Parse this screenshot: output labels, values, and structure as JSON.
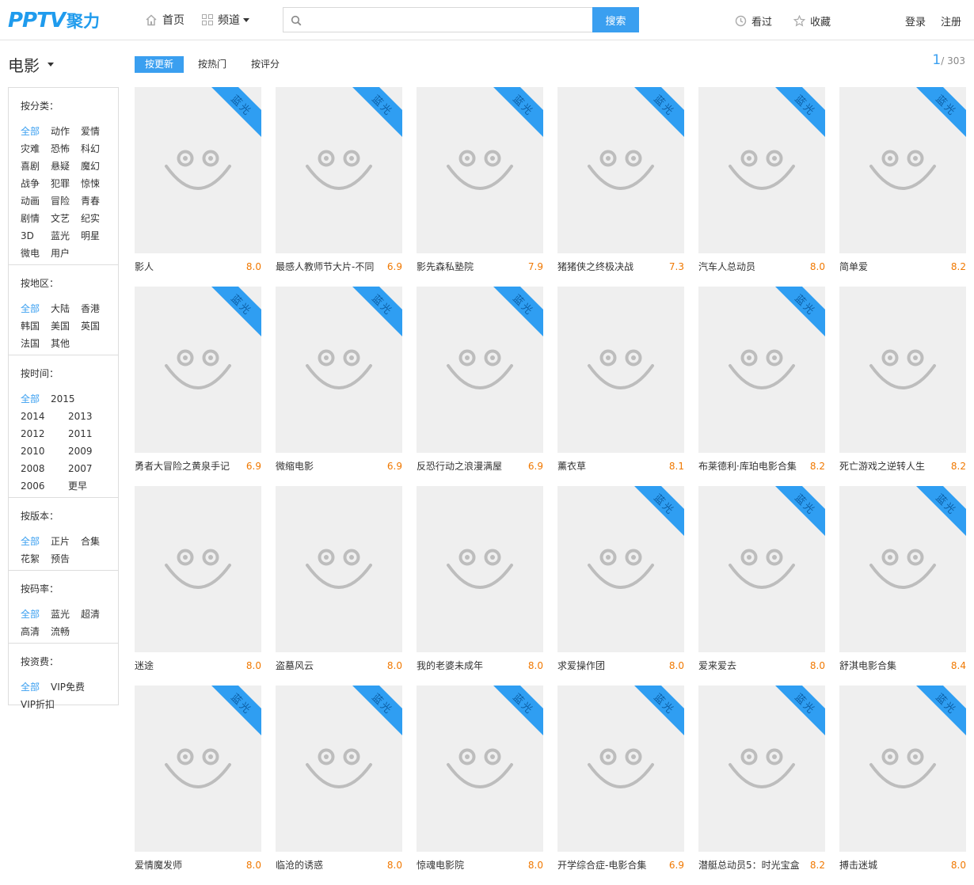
{
  "header": {
    "logo_text": "PPTV",
    "logo_sub": "聚力",
    "nav": [
      {
        "label": "首页"
      },
      {
        "label": "频道"
      }
    ],
    "search": {
      "placeholder": "",
      "button_label": "搜索"
    },
    "history_label": "看过",
    "favorites_label": "收藏",
    "login_label": "登录",
    "register_label": "注册"
  },
  "category": {
    "title": "电影"
  },
  "filters": [
    {
      "title": "按分类：",
      "options": [
        "全部",
        "动作",
        "爱情",
        "灾难",
        "恐怖",
        "科幻",
        "喜剧",
        "悬疑",
        "魔幻",
        "战争",
        "犯罪",
        "惊悚",
        "动画",
        "冒险",
        "青春",
        "剧情",
        "文艺",
        "纪实",
        "3D",
        "蓝光",
        "明星",
        "微电",
        "用户"
      ]
    },
    {
      "title": "按地区：",
      "options": [
        "全部",
        "大陆",
        "香港",
        "韩国",
        "美国",
        "英国",
        "法国",
        "其他"
      ]
    },
    {
      "title": "按时间：",
      "options": [
        "全部",
        "2015",
        "2014",
        "2013",
        "2012",
        "2011",
        "2010",
        "2009",
        "2008",
        "2007",
        "2006",
        "更早"
      ]
    },
    {
      "title": "按版本：",
      "options": [
        "全部",
        "正片",
        "合集",
        "花絮",
        "预告"
      ]
    },
    {
      "title": "按码率：",
      "options": [
        "全部",
        "蓝光",
        "超清",
        "高清",
        "流畅"
      ]
    },
    {
      "title": "按资费：",
      "options": [
        "全部",
        "VIP免费",
        "VIP折扣"
      ]
    }
  ],
  "sort_tabs": [
    {
      "label": "按更新",
      "active": true
    },
    {
      "label": "按热门",
      "active": false
    },
    {
      "label": "按评分",
      "active": false
    }
  ],
  "pager": {
    "current": "1",
    "total": "/ 303"
  },
  "ribbon_label": "蓝光",
  "colors": {
    "accent": "#3a9ff0",
    "score": "#f07800",
    "ribbon": "#2f9ef2"
  },
  "movies": [
    {
      "title": "影人",
      "score": "8.0",
      "bluray": true
    },
    {
      "title": "最感人教师节大片-不同",
      "score": "6.9",
      "bluray": true
    },
    {
      "title": "影先森私塾院",
      "score": "7.9",
      "bluray": true
    },
    {
      "title": "猪猪侠之终极决战",
      "score": "7.3",
      "bluray": true
    },
    {
      "title": "汽车人总动员",
      "score": "8.0",
      "bluray": true
    },
    {
      "title": "简单爱",
      "score": "8.2",
      "bluray": true
    },
    {
      "title": "勇者大冒险之黄泉手记",
      "score": "6.9",
      "bluray": true
    },
    {
      "title": "微缩电影",
      "score": "6.9",
      "bluray": true
    },
    {
      "title": "反恐行动之浪漫满屋",
      "score": "6.9",
      "bluray": true
    },
    {
      "title": "薰衣草",
      "score": "8.1",
      "bluray": false
    },
    {
      "title": "布莱德利·库珀电影合集",
      "score": "8.2",
      "bluray": true
    },
    {
      "title": "死亡游戏之逆转人生",
      "score": "8.2",
      "bluray": false
    },
    {
      "title": "迷途",
      "score": "8.0",
      "bluray": false
    },
    {
      "title": "盗墓风云",
      "score": "8.0",
      "bluray": false
    },
    {
      "title": "我的老婆未成年",
      "score": "8.0",
      "bluray": false
    },
    {
      "title": "求爱操作团",
      "score": "8.0",
      "bluray": true
    },
    {
      "title": "爱来爱去",
      "score": "8.0",
      "bluray": true
    },
    {
      "title": "舒淇电影合集",
      "score": "8.4",
      "bluray": true
    },
    {
      "title": "爱情魔发师",
      "score": "8.0",
      "bluray": true
    },
    {
      "title": "临沧的诱惑",
      "score": "8.0",
      "bluray": true
    },
    {
      "title": "惊魂电影院",
      "score": "8.0",
      "bluray": true
    },
    {
      "title": "开学综合症-电影合集",
      "score": "6.9",
      "bluray": true
    },
    {
      "title": "潜艇总动员5：时光宝盒",
      "score": "8.2",
      "bluray": true
    },
    {
      "title": "搏击迷城",
      "score": "8.0",
      "bluray": true
    }
  ]
}
